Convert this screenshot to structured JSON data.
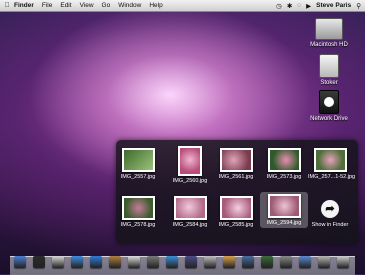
{
  "menubar": {
    "apple_icon": "apple-icon",
    "app_name": "Finder",
    "menus": [
      "File",
      "Edit",
      "View",
      "Go",
      "Window",
      "Help"
    ],
    "user": "Steve Paris"
  },
  "desktop": {
    "icons": [
      {
        "label": "Macintosh HD",
        "icon": "hard-disk-icon"
      },
      {
        "label": "Stoker",
        "icon": "external-disk-icon"
      },
      {
        "label": "Network Drive",
        "icon": "network-drive-icon"
      }
    ]
  },
  "stack": {
    "items": [
      {
        "label": "IMG_2557.jpg",
        "colors": [
          "#3e6b2f",
          "#9bc27a"
        ]
      },
      {
        "label": "IMG_2560.jpg",
        "colors": [
          "#b84d7a",
          "#f0b6cf"
        ]
      },
      {
        "label": "IMG_2561.jpg",
        "colors": [
          "#7a3d4f",
          "#e2a3b8"
        ]
      },
      {
        "label": "IMG_2573.jpg",
        "colors": [
          "#2f5a2a",
          "#e88eb0"
        ]
      },
      {
        "label": "IMG_257...1-52.jpg",
        "colors": [
          "#4f6e3a",
          "#e7a2bc"
        ]
      },
      {
        "label": "IMG_2578.jpg",
        "colors": [
          "#3a5c2c",
          "#c77a9a"
        ]
      },
      {
        "label": "IMG_2584.jpg",
        "colors": [
          "#b06a88",
          "#f3c9da"
        ]
      },
      {
        "label": "IMG_2585.jpg",
        "colors": [
          "#a65a7a",
          "#f4cfe0"
        ]
      },
      {
        "label": "IMG_2594.jpg",
        "colors": [
          "#9e5a73",
          "#ecc4d3"
        ]
      },
      {
        "label": "Show in Finder",
        "icon": "show-in-finder-icon"
      }
    ]
  },
  "dock": {
    "icons": [
      {
        "name": "finder-icon",
        "color": "#4a7fd4"
      },
      {
        "name": "dashboard-icon",
        "color": "#2b2b2b"
      },
      {
        "name": "mail-icon",
        "color": "#d9d9d9"
      },
      {
        "name": "safari-icon",
        "color": "#3f8ee0"
      },
      {
        "name": "ichat-icon",
        "color": "#2f7cd6"
      },
      {
        "name": "address-book-icon",
        "color": "#b08040"
      },
      {
        "name": "ical-icon",
        "color": "#e0e0e0"
      },
      {
        "name": "preview-icon",
        "color": "#7a7a7a"
      },
      {
        "name": "itunes-icon",
        "color": "#3a8fd4"
      },
      {
        "name": "iphoto-icon",
        "color": "#4b4b8a"
      },
      {
        "name": "imovie-icon",
        "color": "#c0c0c0"
      },
      {
        "name": "garageband-icon",
        "color": "#d6a04a"
      },
      {
        "name": "spaces-icon",
        "color": "#4a6aa0"
      },
      {
        "name": "time-machine-icon",
        "color": "#3a6a3a"
      },
      {
        "name": "system-preferences-icon",
        "color": "#8a8a8a"
      },
      {
        "name": "applications-folder-icon",
        "color": "#5a8ad0"
      },
      {
        "name": "documents-stack-icon",
        "color": "#b8b8b8"
      },
      {
        "name": "trash-icon",
        "color": "#d0d0d0"
      }
    ]
  }
}
